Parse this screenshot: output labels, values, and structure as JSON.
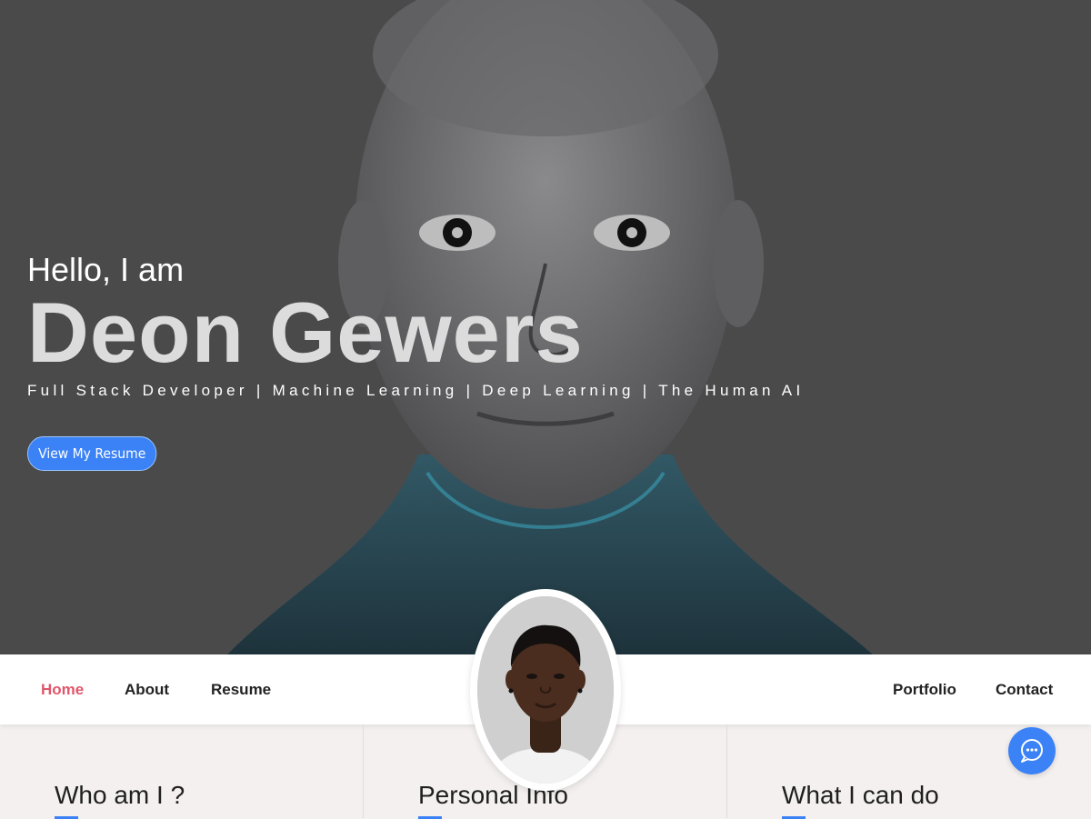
{
  "hero": {
    "greeting": "Hello, I am",
    "name": "Deon Gewers",
    "tagline": "Full Stack Developer | Machine Learning | Deep Learning | The Human AI",
    "cta_label": "View My Resume",
    "background_color": "#4a4a4b"
  },
  "nav": {
    "left_items": [
      {
        "label": "Home",
        "active": true
      },
      {
        "label": "About",
        "active": false
      },
      {
        "label": "Resume",
        "active": false
      }
    ],
    "right_items": [
      {
        "label": "Portfolio",
        "active": false
      },
      {
        "label": "Contact",
        "active": false
      }
    ],
    "active_color": "#e0566b"
  },
  "sections": [
    {
      "title": "Who am I ?"
    },
    {
      "title": "Personal Info"
    },
    {
      "title": "What I can do"
    }
  ],
  "chat": {
    "icon": "chat-bubble-icon"
  },
  "colors": {
    "accent": "#3b82f6",
    "section_bg": "#f4f0ef"
  }
}
